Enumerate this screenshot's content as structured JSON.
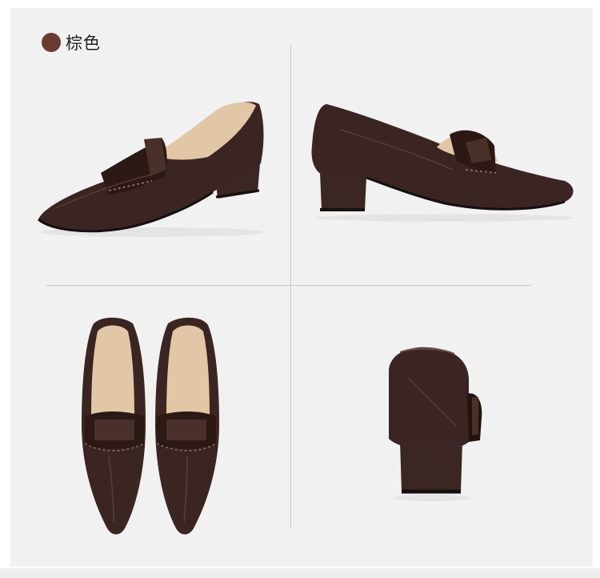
{
  "color_option": {
    "name": "棕色",
    "swatch": "#6b3a32"
  },
  "colors": {
    "leather": "#3b2522",
    "leather_dark": "#23130f",
    "leather_highlight": "#6b504a",
    "lining": "#e2c7a6",
    "heel": "#3a2622",
    "sole": "#141010"
  },
  "views": [
    "side-left-view",
    "side-right-view",
    "top-pair-view",
    "rear-view"
  ]
}
